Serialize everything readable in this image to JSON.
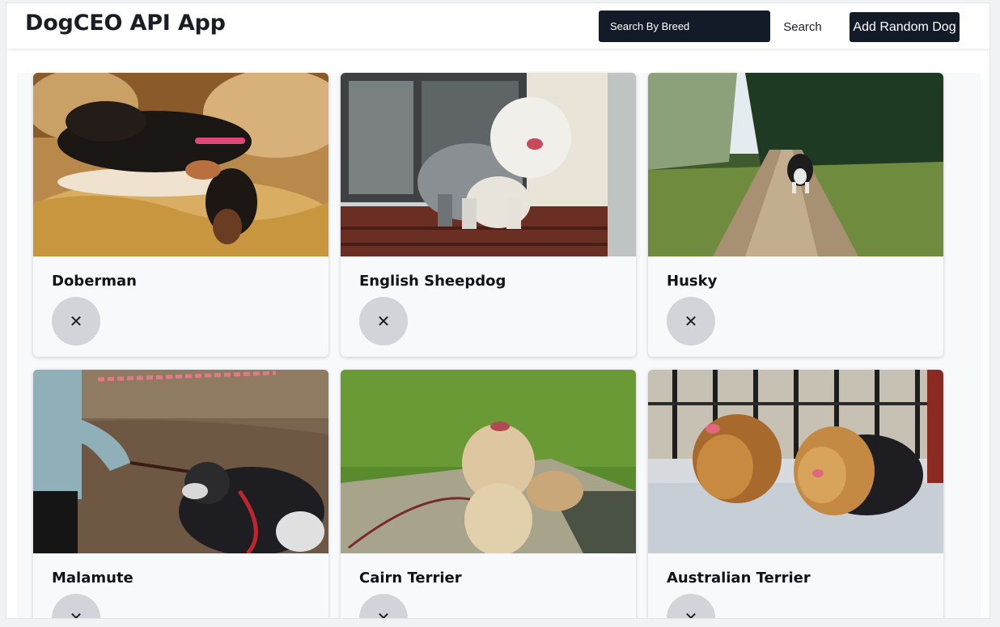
{
  "header": {
    "title": "DogCEO API App",
    "search_placeholder": "Search By Breed",
    "search_value": "",
    "search_label": "Search",
    "add_random_label": "Add Random Dog"
  },
  "dogs": [
    {
      "breed": "Doberman",
      "remove_icon": "✕"
    },
    {
      "breed": "English Sheepdog",
      "remove_icon": "✕"
    },
    {
      "breed": "Husky",
      "remove_icon": "✕"
    },
    {
      "breed": "Malamute",
      "remove_icon": "✕"
    },
    {
      "breed": "Cairn Terrier",
      "remove_icon": "✕"
    },
    {
      "breed": "Australian Terrier",
      "remove_icon": "✕"
    }
  ],
  "colors": {
    "dark_accent": "#141b28",
    "card_background": "#f8f9fa",
    "remove_button_background": "#d2d4d9"
  }
}
